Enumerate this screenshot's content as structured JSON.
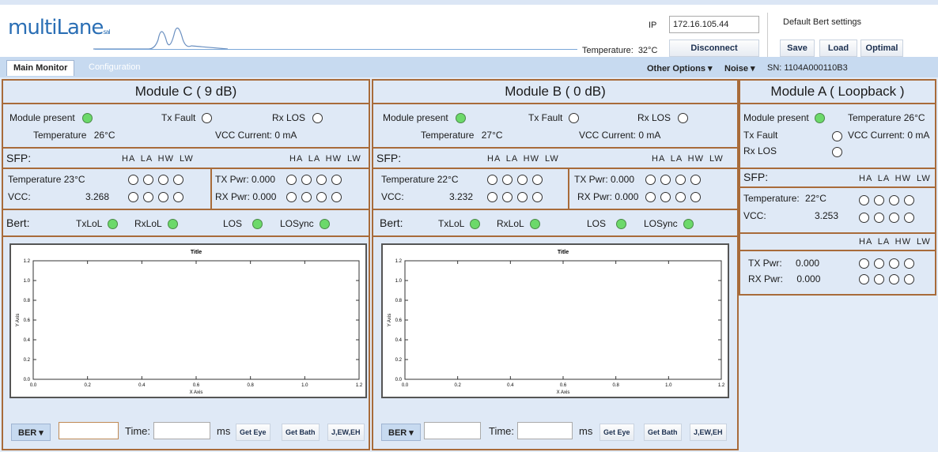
{
  "header": {
    "logo_main": "multi",
    "logo_lane": "Lane",
    "logo_suffix": "sal",
    "ip_label": "IP",
    "ip_value": "172.16.105.44",
    "temperature_label": "Temperature:",
    "temperature_value": "32°C",
    "disconnect_label": "Disconnect",
    "bert_settings_label": "Default Bert settings",
    "save_label": "Save",
    "load_label": "Load",
    "optimal_label": "Optimal"
  },
  "tabs": {
    "main_monitor": "Main Monitor",
    "configuration": "Configuration",
    "other_options": "Other Options ▾",
    "noise": "Noise ▾",
    "sn": "SN: 1104A000110B3"
  },
  "module_c": {
    "title": "Module C ( 9 dB)",
    "module_present": "Module present",
    "tx_fault": "Tx Fault",
    "rx_los": "Rx LOS",
    "temperature_label": "Temperature",
    "temperature_value": "26°C",
    "vcc_current": "VCC Current:  0 mA",
    "sfp": "SFP:",
    "hdr": "HA LA HW LW",
    "sfp_temp_label": "Temperature",
    "sfp_temp_value": "23°C",
    "vcc_label": "VCC:",
    "vcc_value": "3.268",
    "tx_pwr": "TX Pwr: 0.000",
    "rx_pwr": "RX Pwr: 0.000",
    "bert": "Bert:",
    "txlol": "TxLoL",
    "rxlol": "RxLoL",
    "los": "LOS",
    "losync": "LOSync"
  },
  "module_b": {
    "title": "Module B ( 0 dB)",
    "module_present": "Module present",
    "tx_fault": "Tx Fault",
    "rx_los": "Rx LOS",
    "temperature_label": "Temperature",
    "temperature_value": "27°C",
    "vcc_current": "VCC Current:  0 mA",
    "sfp": "SFP:",
    "hdr": "HA LA HW LW",
    "sfp_temp_label": "Temperature",
    "sfp_temp_value": "22°C",
    "vcc_label": "VCC:",
    "vcc_value": "3.232",
    "tx_pwr": "TX Pwr: 0.000",
    "rx_pwr": "RX Pwr: 0.000",
    "bert": "Bert:",
    "txlol": "TxLoL",
    "rxlol": "RxLoL",
    "los": "LOS",
    "losync": "LOSync"
  },
  "module_a": {
    "title": "Module A ( Loopback )",
    "module_present": "Module present",
    "temperature_label": "Temperature",
    "temperature_value": "26°C",
    "tx_fault": "Tx Fault",
    "vcc_current_label": "VCC Current:",
    "vcc_current_value": "0 mA",
    "rx_los": "Rx LOS",
    "sfp": "SFP:",
    "hdr": "HA LA HW LW",
    "sfp_temp_label": "Temperature:",
    "sfp_temp_value": "22°C",
    "vcc_label": "VCC:",
    "vcc_value": "3.253",
    "tx_pwr_label": "TX Pwr:",
    "tx_pwr_value": "0.000",
    "rx_pwr_label": "RX Pwr:",
    "rx_pwr_value": "0.000"
  },
  "bottom": {
    "ber_label": "BER ▾",
    "time_label": "Time:",
    "ms_label": "ms",
    "get_eye": "Get Eye",
    "get_bath": "Get Bath",
    "jew": "J,EW,EH"
  },
  "chart_data": [
    {
      "type": "line",
      "title": "Title",
      "xlabel": "X Axis",
      "ylabel": "Y Axis",
      "xlim": [
        0.0,
        1.2
      ],
      "ylim": [
        0.0,
        1.2
      ],
      "xticks": [
        "0.0",
        "0.2",
        "0.4",
        "0.6",
        "0.8",
        "1.0",
        "1.2"
      ],
      "yticks": [
        "0.0",
        "0.2",
        "0.4",
        "0.6",
        "0.8",
        "1.0",
        "1.2"
      ],
      "series": []
    },
    {
      "type": "line",
      "title": "Title",
      "xlabel": "X Axis",
      "ylabel": "Y Axis",
      "xlim": [
        0.0,
        1.2
      ],
      "ylim": [
        0.0,
        1.2
      ],
      "xticks": [
        "0.0",
        "0.2",
        "0.4",
        "0.6",
        "0.8",
        "1.0",
        "1.2"
      ],
      "yticks": [
        "0.0",
        "0.2",
        "0.4",
        "0.6",
        "0.8",
        "1.0",
        "1.2"
      ],
      "series": []
    }
  ]
}
